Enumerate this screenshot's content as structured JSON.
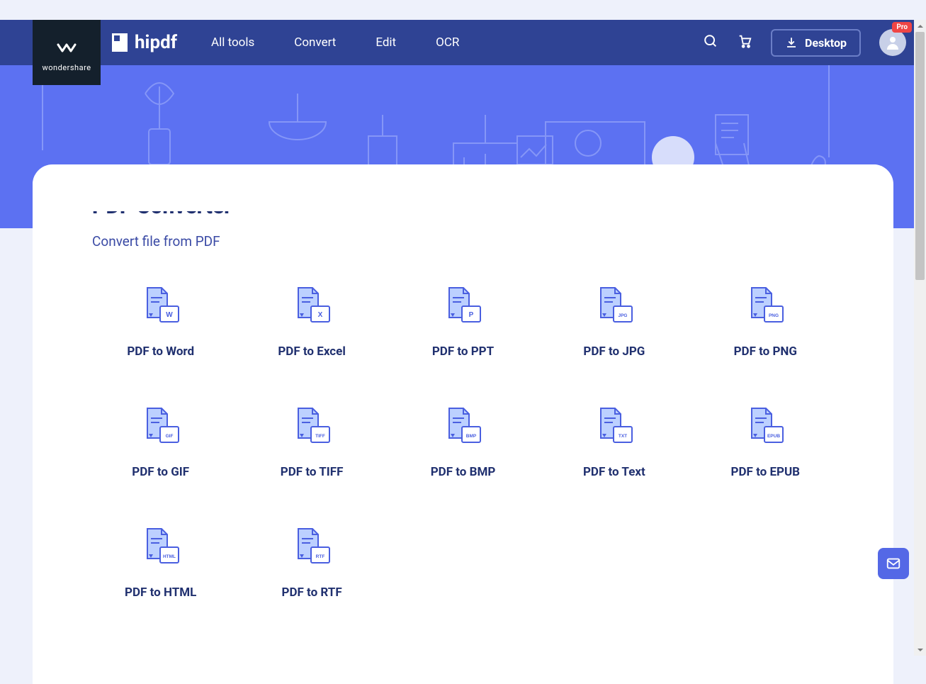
{
  "brand": {
    "name": "wondershare"
  },
  "header": {
    "logo": "hipdf",
    "nav": {
      "all_tools": "All tools",
      "convert": "Convert",
      "edit": "Edit",
      "ocr": "OCR"
    },
    "desktop_btn": "Desktop",
    "avatar_badge": "Pro"
  },
  "main": {
    "title": "PDF Converter",
    "subtitle": "Convert file from PDF"
  },
  "tools": [
    {
      "label": "PDF to Word",
      "tag": "W"
    },
    {
      "label": "PDF to Excel",
      "tag": "X"
    },
    {
      "label": "PDF to PPT",
      "tag": "P"
    },
    {
      "label": "PDF to JPG",
      "tag": "JPG"
    },
    {
      "label": "PDF to PNG",
      "tag": "PNG"
    },
    {
      "label": "PDF to GIF",
      "tag": "GIF"
    },
    {
      "label": "PDF to TIFF",
      "tag": "TIFF"
    },
    {
      "label": "PDF to BMP",
      "tag": "BMP"
    },
    {
      "label": "PDF to Text",
      "tag": "TXT"
    },
    {
      "label": "PDF to EPUB",
      "tag": "EPUB"
    },
    {
      "label": "PDF to HTML",
      "tag": "HTML"
    },
    {
      "label": "PDF to RTF",
      "tag": "RTF"
    }
  ],
  "colors": {
    "accent": "#5c71f2",
    "navbar": "#2f4394",
    "brand_dark": "#14202c",
    "text": "#20306f",
    "badge": "#ef4545"
  }
}
